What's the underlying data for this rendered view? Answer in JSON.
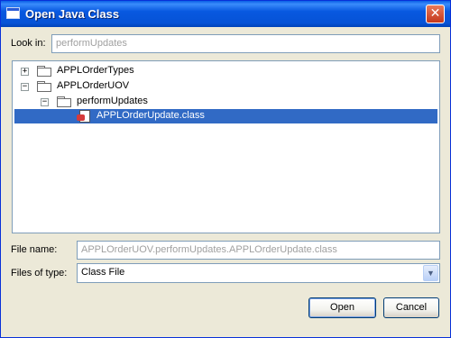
{
  "window": {
    "title": "Open Java Class",
    "close_glyph": "✕"
  },
  "look_in": {
    "label": "Look in:",
    "value": "performUpdates"
  },
  "tree": {
    "nodes": [
      {
        "label": "APPLOrderTypes",
        "expander": "+",
        "icon": "folder-icon"
      },
      {
        "label": "APPLOrderUOV",
        "expander": "−",
        "icon": "folder-icon"
      },
      {
        "label": "performUpdates",
        "expander": "−",
        "icon": "folder-open-icon"
      },
      {
        "label": "APPLOrderUpdate.class",
        "icon": "class-file-icon",
        "selected": true
      }
    ]
  },
  "file_name": {
    "label": "File name:",
    "value": "APPLOrderUOV.performUpdates.APPLOrderUpdate.class"
  },
  "file_type": {
    "label": "Files of type:",
    "value": "Class File"
  },
  "buttons": {
    "open": "Open",
    "cancel": "Cancel"
  },
  "colors": {
    "title_bar": "#0858e0",
    "selection": "#316ac5",
    "dialog_bg": "#ece9d8"
  }
}
